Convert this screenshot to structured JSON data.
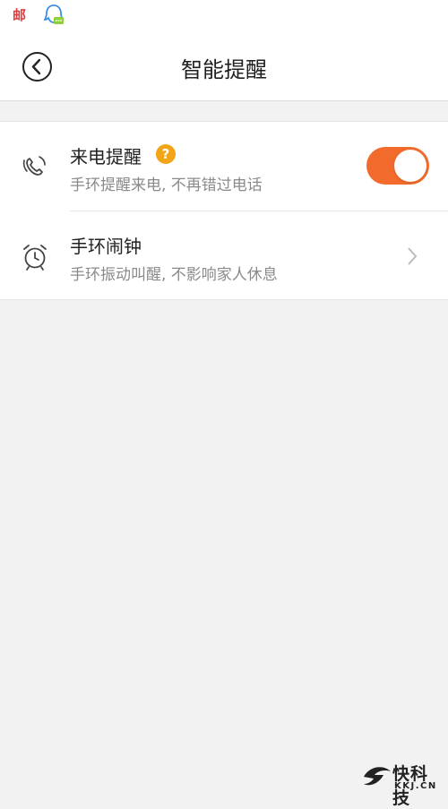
{
  "statusbar": {
    "mail_glyph": "邮",
    "icons": [
      "mail-icon",
      "qq-chat-icon"
    ]
  },
  "header": {
    "title": "智能提醒",
    "back_icon": "chevron-left-circle-icon"
  },
  "settings": [
    {
      "title": "来电提醒",
      "subtitle": "手环提醒来电, 不再错过电话",
      "icon": "phone-ringing-icon",
      "help_label": "?",
      "toggle_on": true
    },
    {
      "title": "手环闹钟",
      "subtitle": "手环振动叫醒, 不影响家人休息",
      "icon": "alarm-clock-icon",
      "trailing": "chevron-right-icon"
    }
  ],
  "watermark": {
    "text": "快科技",
    "url": "KKJ.CN"
  },
  "colors": {
    "accent": "#f26b2c",
    "help": "#f3a51a",
    "background": "#f2f2f2"
  }
}
